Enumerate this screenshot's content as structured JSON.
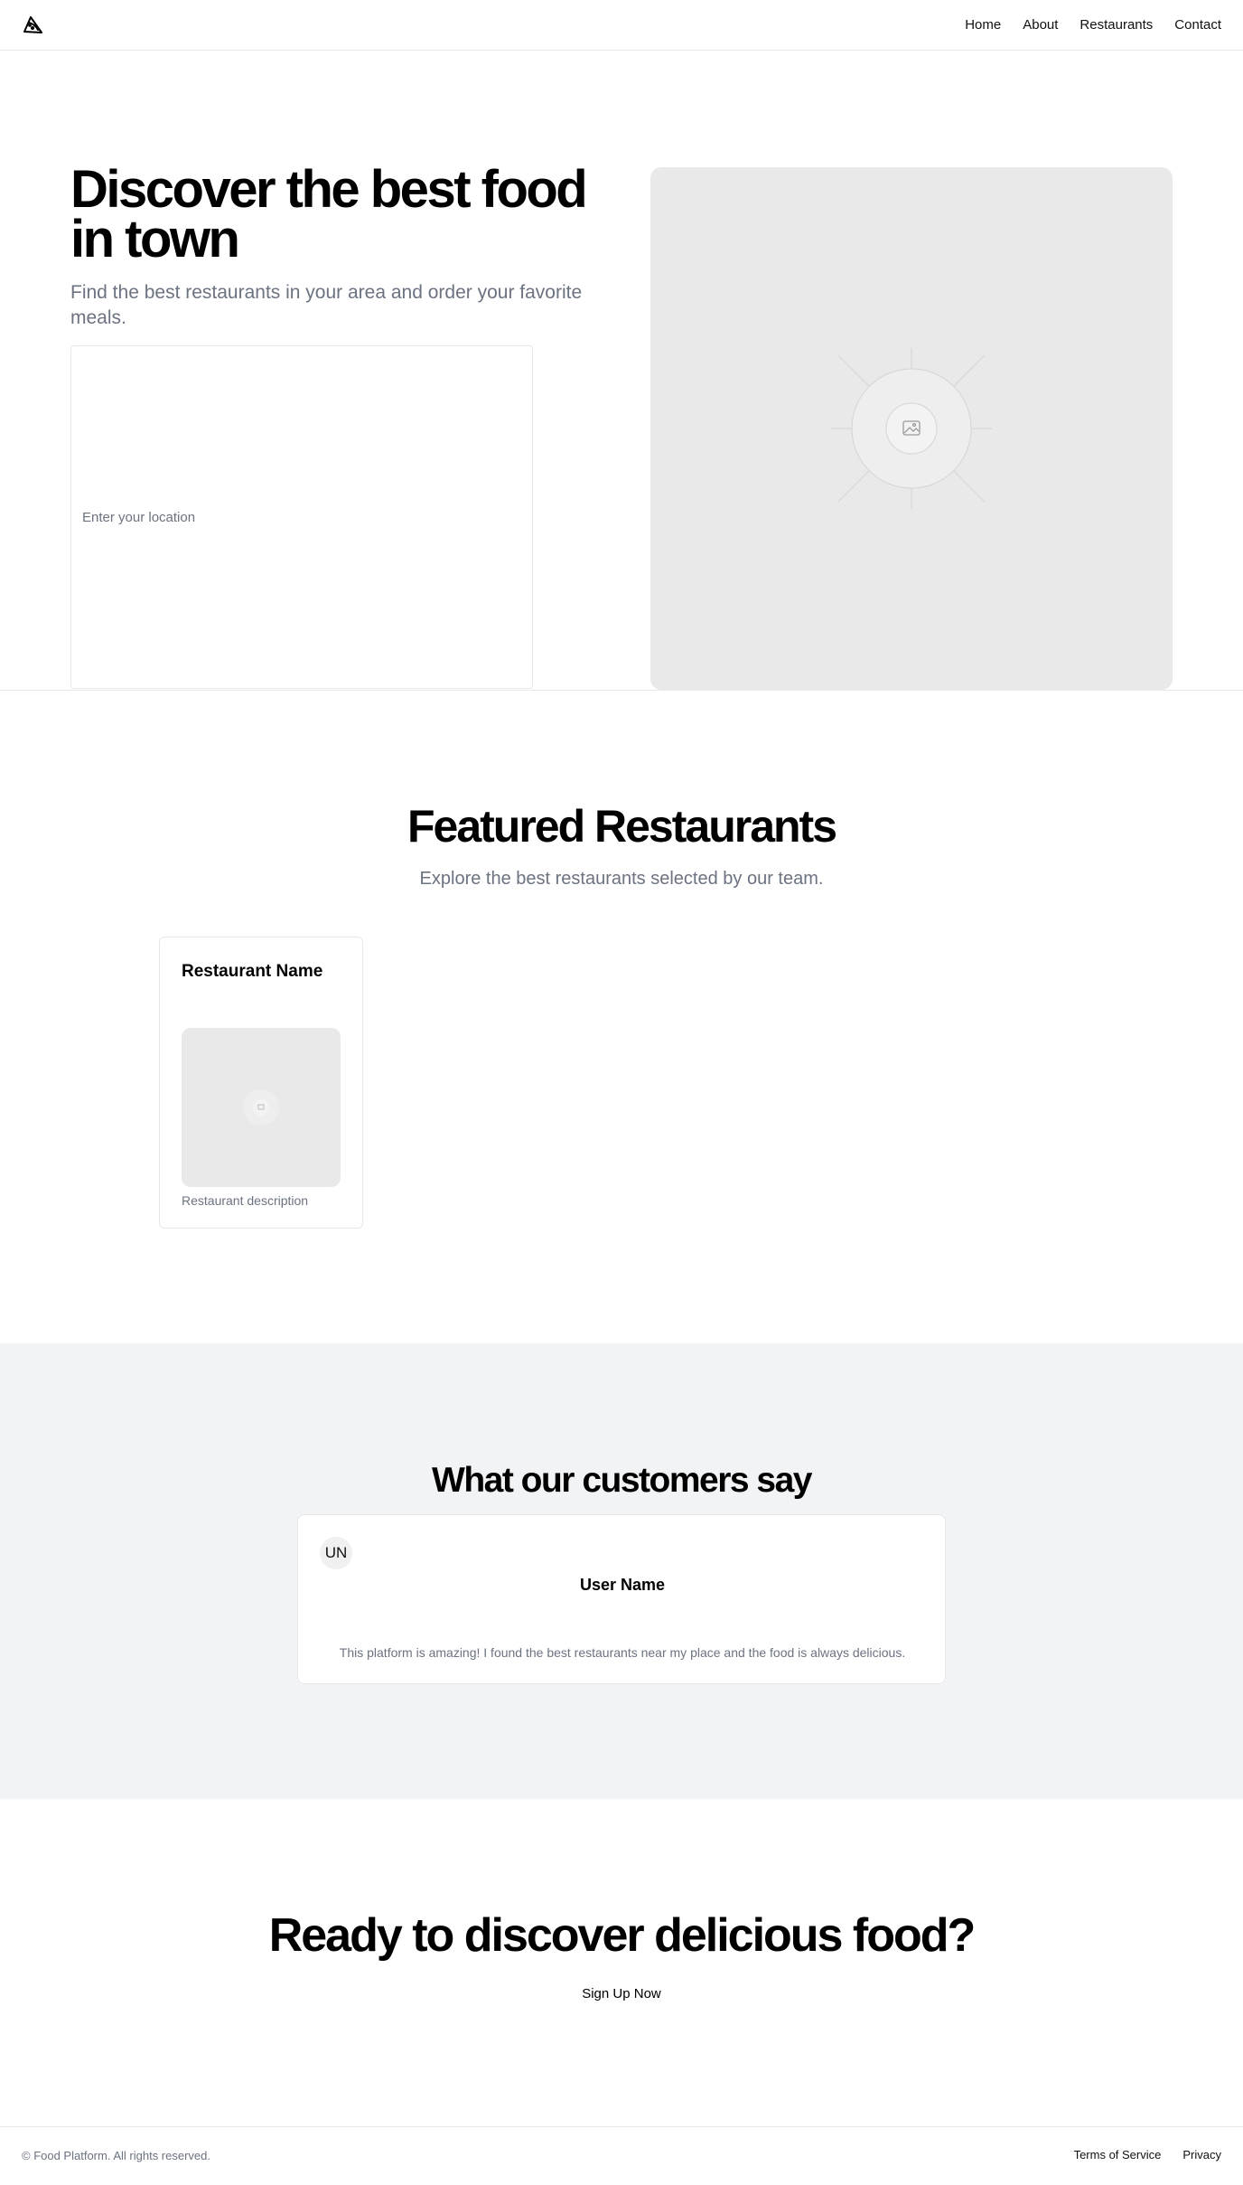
{
  "header": {
    "logo_icon": "pizza-slice-icon",
    "nav": [
      {
        "label": "Home"
      },
      {
        "label": "About"
      },
      {
        "label": "Restaurants"
      },
      {
        "label": "Contact"
      }
    ]
  },
  "hero": {
    "title": "Discover the best food in town",
    "subtitle": "Find the best restaurants in your area and order your favorite meals.",
    "location_placeholder": "Enter your location",
    "image_icon": "image-placeholder-icon"
  },
  "featured": {
    "title": "Featured Restaurants",
    "subtitle": "Explore the best restaurants selected by our team.",
    "restaurants": [
      {
        "name": "Restaurant Name",
        "description": "Restaurant description",
        "image_icon": "image-placeholder-icon"
      }
    ]
  },
  "testimonials": {
    "title": "What our customers say",
    "items": [
      {
        "initials": "UN",
        "user": "User Name",
        "quote": "This platform is amazing! I found the best restaurants near my place and the food is always delicious."
      }
    ]
  },
  "cta": {
    "title": "Ready to discover delicious food?",
    "button_label": "Sign Up Now"
  },
  "footer": {
    "copyright": "© Food Platform. All rights reserved.",
    "links": [
      {
        "label": "Terms of Service"
      },
      {
        "label": "Privacy"
      }
    ]
  },
  "colors": {
    "muted_text": "#6b7280",
    "border": "#e5e7eb",
    "section_bg": "#f2f3f5",
    "placeholder_bg": "#e9e9e9"
  }
}
